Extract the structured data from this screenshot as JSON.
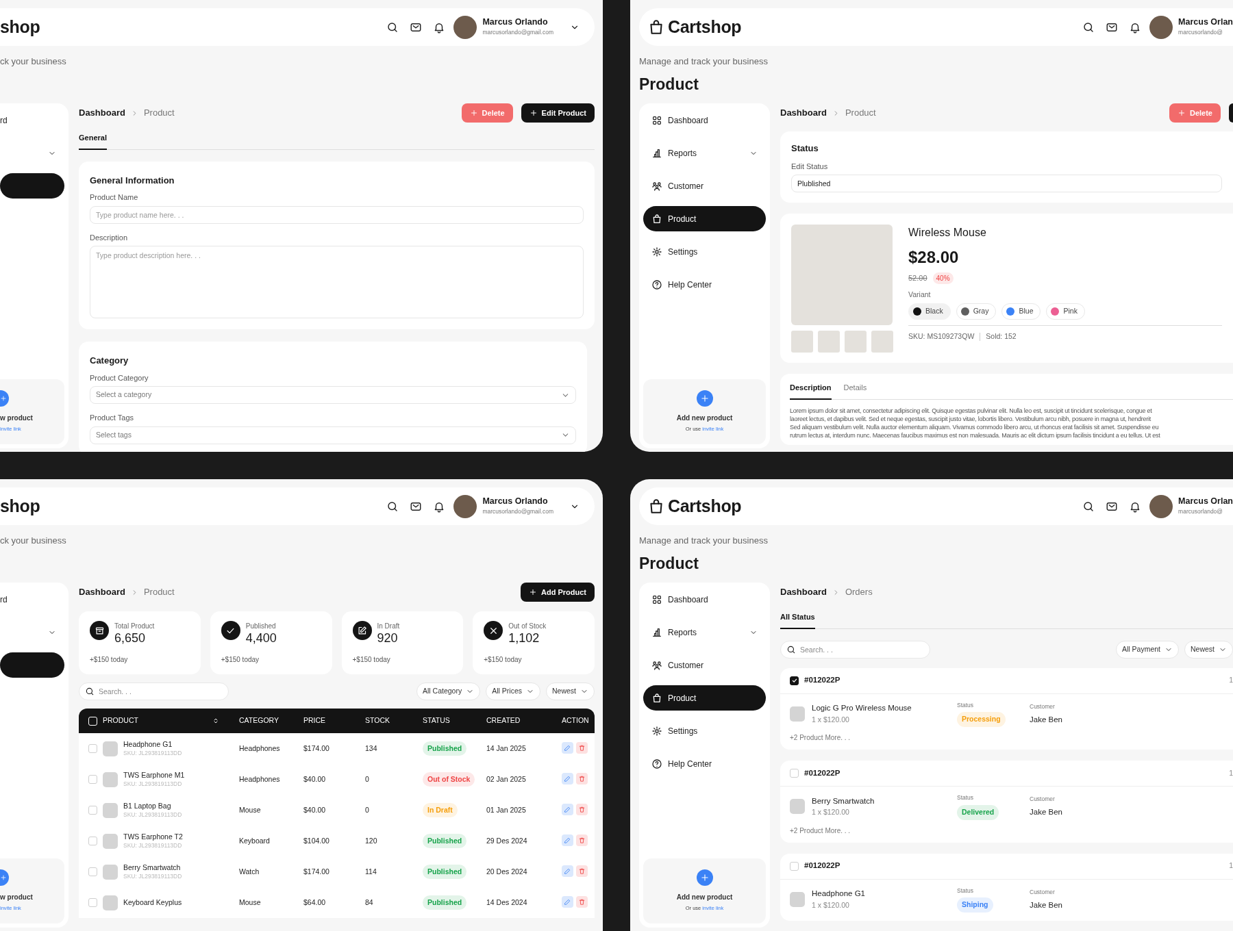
{
  "panels": [
    {
      "kind": "product_form",
      "header": {
        "logo": "shop",
        "user_name": "Marcus Orlando",
        "user_email": "marcusorlando@gmail.com"
      },
      "subtitle": "ck your business",
      "sidebar": {
        "items": [
          {
            "kind": "link",
            "label": "rd",
            "selected": false
          },
          {
            "kind": "group",
            "selected": false
          },
          {
            "kind": "link",
            "selected": true
          }
        ],
        "add_card": {
          "title": "w product",
          "link": "invite link"
        }
      },
      "main": {
        "breadcrumb": [
          "Dashboard",
          "Product"
        ],
        "actions": [
          {
            "kind": "danger",
            "label": "Delete"
          },
          {
            "kind": "dark",
            "label": "Edit Product"
          }
        ],
        "tabs": [
          {
            "label": "General",
            "selected": true
          }
        ],
        "sections": [
          {
            "title": "General Information",
            "fields": [
              {
                "kind": "text",
                "label": "Product Name",
                "placeholder": "Type product name here. . ."
              },
              {
                "kind": "textarea",
                "label": "Description",
                "placeholder": "Type product description here. . ."
              }
            ]
          },
          {
            "title": "Category",
            "fields": [
              {
                "kind": "select",
                "label": "Product Category",
                "placeholder": "Select a category"
              },
              {
                "kind": "select",
                "label": "Product Tags",
                "placeholder": "Select tags"
              }
            ]
          }
        ]
      }
    },
    {
      "kind": "product_detail",
      "header": {
        "logo": "Cartshop",
        "user_name": "Marcus Orlan",
        "user_email": "marcusorlando@"
      },
      "subtitle": "Manage and track your business",
      "title": "Product",
      "sidebar": {
        "items": [
          {
            "kind": "link",
            "label": "Dashboard",
            "selected": false
          },
          {
            "kind": "group",
            "label": "Reports",
            "selected": false
          },
          {
            "kind": "link",
            "label": "Customer",
            "selected": false
          },
          {
            "kind": "link",
            "label": "Product",
            "selected": true
          },
          {
            "kind": "link",
            "label": "Settings",
            "selected": false
          },
          {
            "kind": "link",
            "label": "Help Center",
            "selected": false
          }
        ],
        "add_card": {
          "title": "Add new product",
          "hint": "Or use",
          "link": "invite link"
        }
      },
      "main": {
        "breadcrumb": [
          "Dashboard",
          "Product"
        ],
        "actions": [
          {
            "kind": "danger",
            "label": "Delete"
          },
          {
            "kind": "dark"
          }
        ],
        "status": {
          "title": "Status",
          "label": "Edit Status",
          "value": "Plublished"
        },
        "product": {
          "name": "Wireless Mouse",
          "price": "$28.00",
          "old_price": "52.00",
          "discount": "40%",
          "variant_label": "Variant",
          "variants": [
            {
              "label": "Black",
              "color": "#111111",
              "selected": true
            },
            {
              "label": "Gray",
              "color": "#5f5f5f",
              "selected": false
            },
            {
              "label": "Blue",
              "color": "#3b82f6",
              "selected": false
            },
            {
              "label": "Pink",
              "color": "#ec5f93",
              "selected": false
            }
          ],
          "sku": "SKU: MS109273QW",
          "sold": "Sold: 152"
        },
        "description": {
          "tabs": [
            {
              "label": "Description",
              "selected": true
            },
            {
              "label": "Details",
              "selected": false
            }
          ],
          "lines": [
            "Lorem ipsum dolor sit amet, consectetur adipiscing elit. Quisque egestas pulvinar elit. Nulla leo est, suscipit ut tincidunt scelerisque, congue et",
            "laoreet lectus, et dapibus velit. Sed et neque egestas, suscipit justo vitae, lobortis libero. Vestibulum arcu nibh, posuere in magna ut, hendrerit",
            "Sed aliquam vestibulum velit. Nulla auctor elementum aliquam. Vivamus commodo libero arcu, ut rhoncus erat facilisis sit amet. Suspendisse eu",
            "rutrum lectus at, interdum nunc. Maecenas faucibus maximus est non malesuada. Mauris ac elit dictum ipsum facilisis tincidunt a eu tellus. Ut est"
          ]
        }
      }
    },
    {
      "kind": "product_list",
      "header": {
        "logo": "shop",
        "user_name": "Marcus Orlando",
        "user_email": "marcusorlando@gmail.com"
      },
      "subtitle": "ck your business",
      "sidebar": {
        "items": [
          {
            "kind": "link",
            "label": "rd",
            "selected": false
          },
          {
            "kind": "group",
            "selected": false
          },
          {
            "kind": "link",
            "selected": true
          }
        ],
        "add_card": {
          "title": "w product",
          "link": "invite link"
        }
      },
      "main": {
        "breadcrumb": [
          "Dashboard",
          "Product"
        ],
        "actions": [
          {
            "kind": "dark",
            "label": "Add Product"
          }
        ],
        "stats": [
          {
            "label": "Total Product",
            "value": "6,650",
            "delta": "+$150 today"
          },
          {
            "label": "Published",
            "value": "4,400",
            "delta": "+$150 today"
          },
          {
            "label": "In Draft",
            "value": "920",
            "delta": "+$150 today"
          },
          {
            "label": "Out of Stock",
            "value": "1,102",
            "delta": "+$150 today"
          }
        ],
        "search": {
          "placeholder": "Search. . ."
        },
        "filters": [
          "All Category",
          "All Prices",
          "Newest"
        ],
        "table": {
          "header_checked": false,
          "columns": [
            "PRODUCT",
            "CATEGORY",
            "PRICE",
            "STOCK",
            "STATUS",
            "CREATED",
            "ACTION"
          ],
          "rows": [
            {
              "checked": false,
              "name": "Headphone G1",
              "sku": "SKU: JL293819113DD",
              "category": "Headphones",
              "price": "$174.00",
              "stock": "134",
              "status": {
                "label": "Published",
                "color": "#16a34a"
              },
              "created": "14 Jan 2025"
            },
            {
              "checked": false,
              "name": "TWS Earphone M1",
              "sku": "SKU: JL293819113DD",
              "category": "Headphones",
              "price": "$40.00",
              "stock": "0",
              "status": {
                "label": "Out of Stock",
                "color": "#ef4444"
              },
              "created": "02 Jan 2025"
            },
            {
              "checked": false,
              "name": "B1 Laptop Bag",
              "sku": "SKU: JL293819113DD",
              "category": "Mouse",
              "price": "$40.00",
              "stock": "0",
              "status": {
                "label": "In Draft",
                "color": "#f59e0b"
              },
              "created": "01 Jan 2025"
            },
            {
              "checked": false,
              "name": "TWS Earphone T2",
              "sku": "SKU: JL293819113DD",
              "category": "Keyboard",
              "price": "$104.00",
              "stock": "120",
              "status": {
                "label": "Published",
                "color": "#16a34a"
              },
              "created": "29 Des 2024"
            },
            {
              "checked": false,
              "name": "Berry Smartwatch",
              "sku": "SKU: JL293819113DD",
              "category": "Watch",
              "price": "$174.00",
              "stock": "114",
              "status": {
                "label": "Published",
                "color": "#16a34a"
              },
              "created": "20 Des 2024"
            },
            {
              "checked": false,
              "name": "Keyboard Keyplus",
              "category": "Mouse",
              "price": "$64.00",
              "stock": "84",
              "status": {
                "label": "Published",
                "color": "#16a34a"
              },
              "created": "14 Des 2024"
            }
          ]
        }
      }
    },
    {
      "kind": "orders",
      "header": {
        "logo": "Cartshop",
        "user_name": "Marcus Orlan",
        "user_email": "marcusorlando@"
      },
      "subtitle": "Manage and track your business",
      "title": "Product",
      "sidebar": {
        "items": [
          {
            "kind": "link",
            "label": "Dashboard",
            "selected": false
          },
          {
            "kind": "group",
            "label": "Reports",
            "selected": false
          },
          {
            "kind": "link",
            "label": "Customer",
            "selected": false
          },
          {
            "kind": "link",
            "label": "Product",
            "selected": true
          },
          {
            "kind": "link",
            "label": "Settings",
            "selected": false
          },
          {
            "kind": "link",
            "label": "Help Center",
            "selected": false
          }
        ],
        "add_card": {
          "title": "Add new product",
          "hint": "Or use",
          "link": "invite link"
        }
      },
      "main": {
        "breadcrumb": [
          "Dashboard",
          "Orders"
        ],
        "tabs": [
          {
            "label": "All Status",
            "selected": true
          }
        ],
        "search": {
          "placeholder": "Search. . ."
        },
        "filters": [
          "All Payment",
          "Newest"
        ],
        "orders": [
          {
            "checked": true,
            "id": "#012022P",
            "column_3": "1",
            "item": {
              "name": "Logic G Pro Wireless Mouse",
              "qty": "1 x $120.00"
            },
            "status_label": "Status",
            "status": {
              "label": "Processing",
              "color": "#f59e0b"
            },
            "customer_label": "Customer",
            "customer": "Jake Ben",
            "more": "+2 Product More. . ."
          },
          {
            "checked": false,
            "id": "#012022P",
            "column_3": "1",
            "item": {
              "name": "Berry Smartwatch",
              "qty": "1 x $120.00"
            },
            "status_label": "Status",
            "status": {
              "label": "Delivered",
              "color": "#16a34a"
            },
            "customer_label": "Customer",
            "customer": "Jake Ben",
            "more": "+2 Product More. . ."
          },
          {
            "checked": false,
            "id": "#012022P",
            "column_3": "1",
            "item": {
              "name": "Headphone G1",
              "qty": "1 x $120.00"
            },
            "status_label": "Status",
            "status": {
              "label": "Shiping",
              "color": "#3b82f6"
            },
            "customer_label": "Customer",
            "customer": "Jake Ben"
          }
        ]
      }
    }
  ]
}
